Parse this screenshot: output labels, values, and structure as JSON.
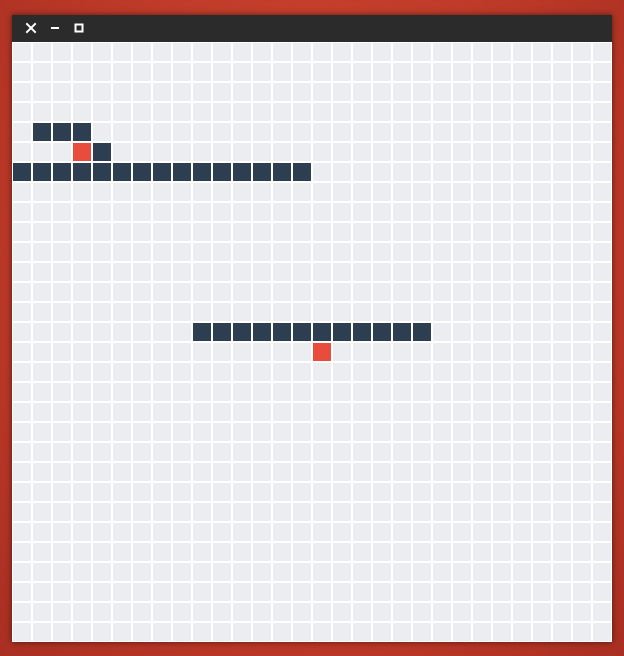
{
  "window": {
    "titlebar_buttons": [
      {
        "name": "close-button",
        "icon": "close-icon"
      },
      {
        "name": "minimize-button",
        "icon": "minimize-icon"
      },
      {
        "name": "maximize-button",
        "icon": "maximize-icon"
      }
    ]
  },
  "colors": {
    "background": "#c0392b",
    "titlebar": "#2b2b2b",
    "empty_cell": "#ecedf1",
    "grid_line": "#ffffff",
    "snake": "#2c3e50",
    "food": "#e74c3c"
  },
  "game": {
    "columns": 30,
    "rows": 30,
    "snakes": [
      {
        "name": "snake-1",
        "cells": [
          [
            1,
            4
          ],
          [
            2,
            4
          ],
          [
            3,
            4
          ],
          [
            4,
            5
          ],
          [
            0,
            6
          ],
          [
            1,
            6
          ],
          [
            2,
            6
          ],
          [
            3,
            6
          ],
          [
            4,
            6
          ],
          [
            5,
            6
          ],
          [
            6,
            6
          ],
          [
            7,
            6
          ],
          [
            8,
            6
          ],
          [
            9,
            6
          ],
          [
            10,
            6
          ],
          [
            11,
            6
          ],
          [
            12,
            6
          ],
          [
            13,
            6
          ],
          [
            14,
            6
          ]
        ]
      },
      {
        "name": "snake-2",
        "cells": [
          [
            9,
            14
          ],
          [
            10,
            14
          ],
          [
            11,
            14
          ],
          [
            12,
            14
          ],
          [
            13,
            14
          ],
          [
            14,
            14
          ],
          [
            15,
            14
          ],
          [
            16,
            14
          ],
          [
            17,
            14
          ],
          [
            18,
            14
          ],
          [
            19,
            14
          ],
          [
            20,
            14
          ]
        ]
      }
    ],
    "food": [
      [
        3,
        5
      ],
      [
        15,
        15
      ]
    ]
  }
}
